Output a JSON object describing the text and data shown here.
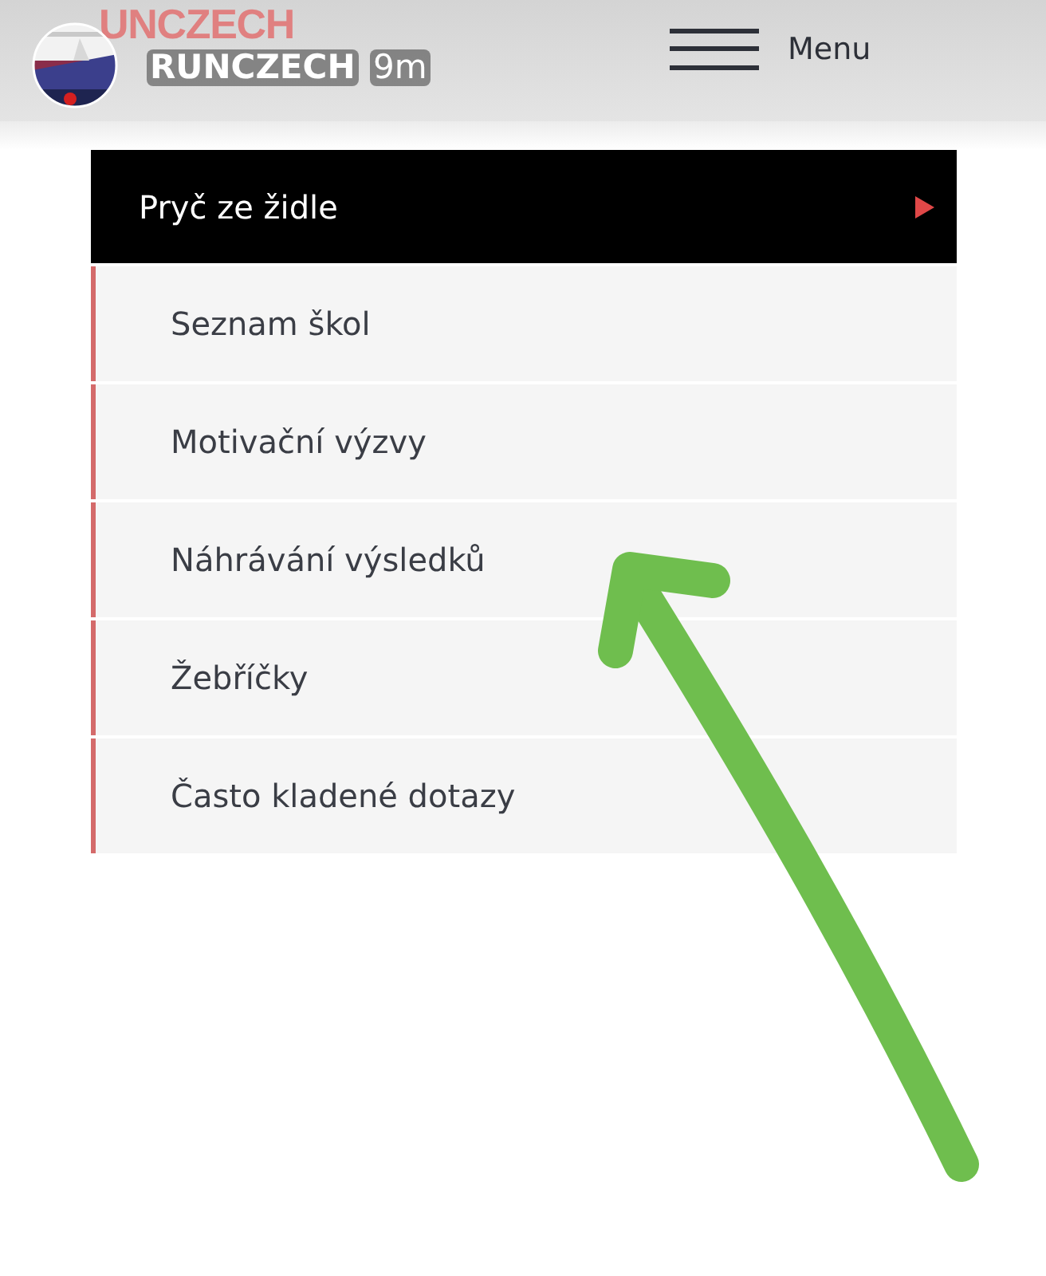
{
  "story_overlay": {
    "account": "RUNCZECH",
    "age": "9m"
  },
  "header": {
    "logo": "UNCZECH",
    "menu_label": "Menu"
  },
  "menu": {
    "title": "Pryč ze židle",
    "expanded": true,
    "items": [
      {
        "label": "Seznam škol"
      },
      {
        "label": "Motivační výzvy"
      },
      {
        "label": "Náhrávání výsledků"
      },
      {
        "label": "Žebříčky"
      },
      {
        "label": "Často kladené dotazy"
      }
    ]
  }
}
